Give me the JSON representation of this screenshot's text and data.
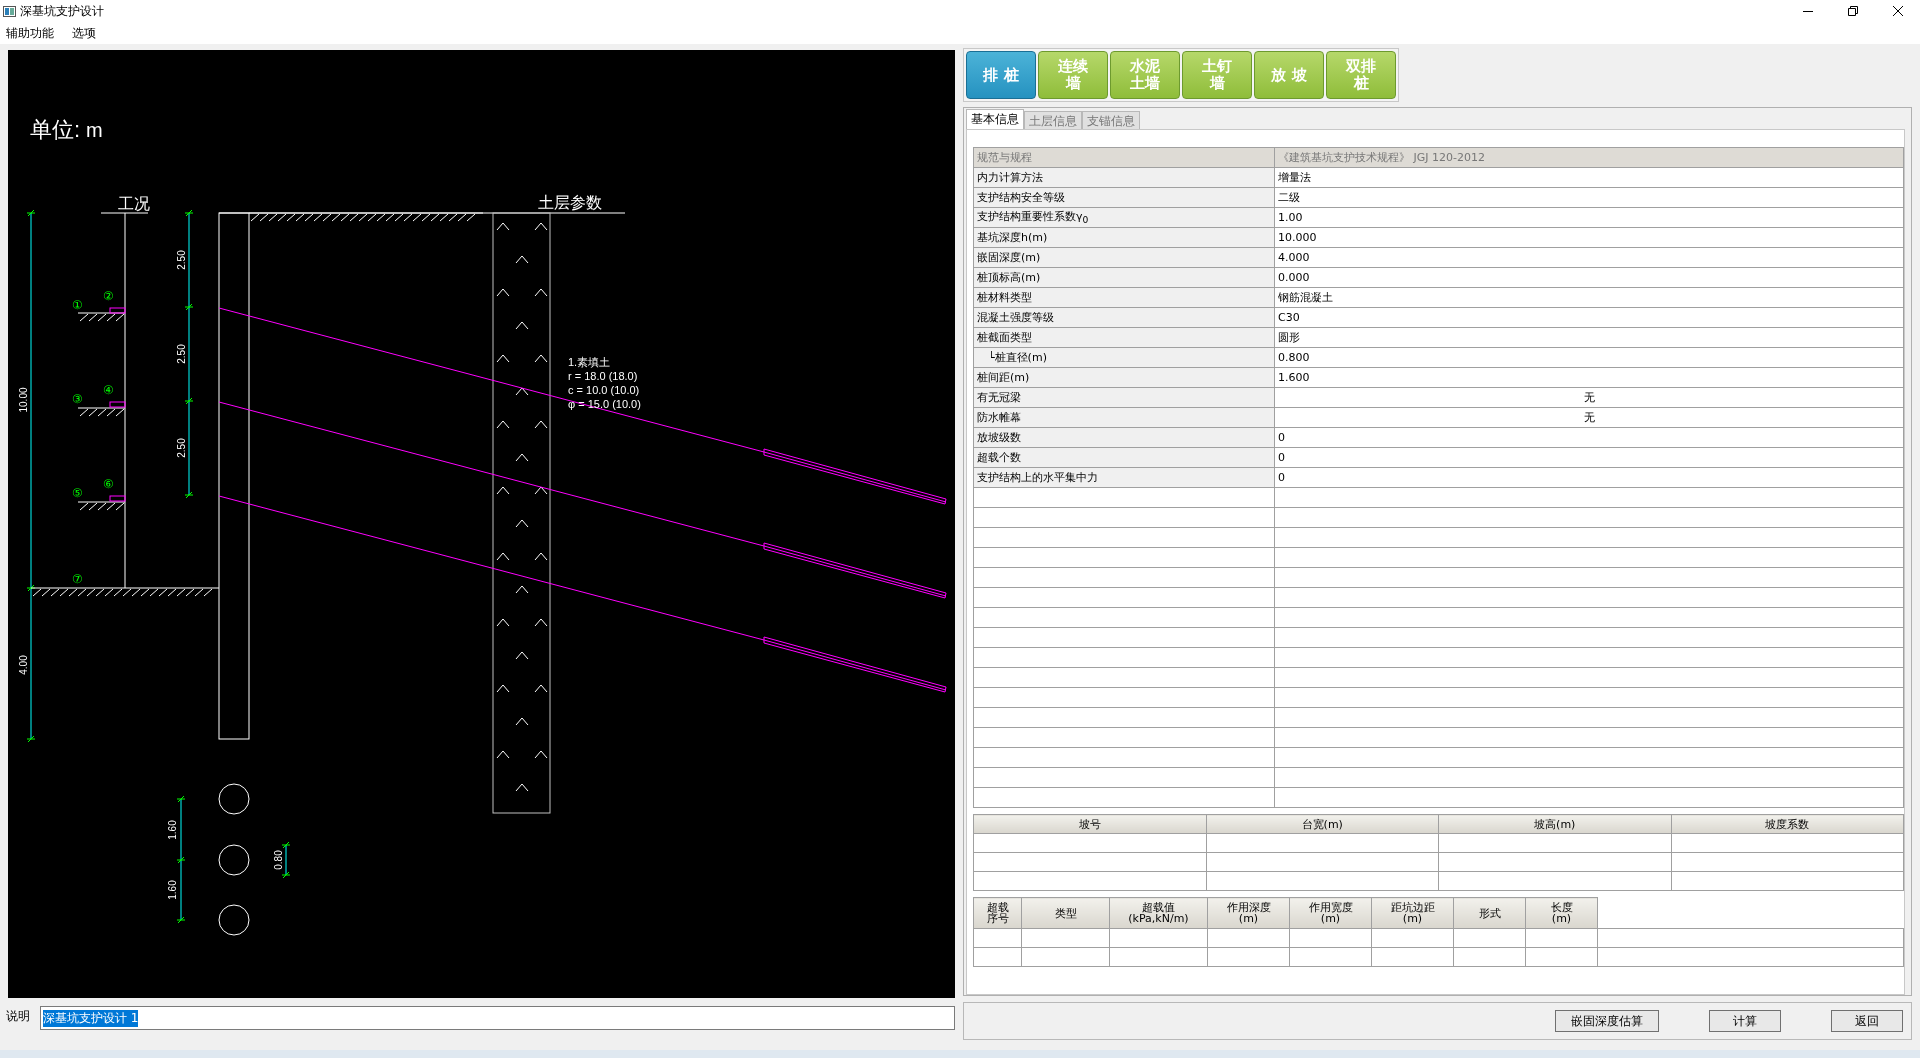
{
  "window": {
    "title": "深基坑支护设计"
  },
  "menu": [
    "辅助功能",
    "选项"
  ],
  "drawing": {
    "unit_label": "单位:",
    "unit": "m",
    "stage_title": "工况",
    "soil_title": "土层参数",
    "depth_dims": [
      "10.00",
      "4.00"
    ],
    "anchor_dims": [
      "2.50",
      "2.50",
      "2.50"
    ],
    "stage_marks": [
      "①",
      "②",
      "③",
      "④",
      "⑤",
      "⑥",
      "⑦"
    ],
    "soil_layer": [
      "1.素填土",
      "r = 18.0 (18.0)",
      "c = 10.0 (10.0)",
      "φ = 15.0 (10.0)"
    ],
    "spacing_dims": [
      "1.60",
      "1.60"
    ],
    "diameter_dim": "0.80"
  },
  "note": {
    "label": "说明",
    "value": "深基坑支护设计 1",
    "text_selected": true
  },
  "pile_types": [
    {
      "label": "排 桩",
      "selected": true
    },
    {
      "label": "连续墙",
      "selected": false
    },
    {
      "label": "水泥土墙",
      "selected": false
    },
    {
      "label": "土钉墙",
      "selected": false
    },
    {
      "label": "放 坡",
      "selected": false
    },
    {
      "label": "双排桩",
      "selected": false
    }
  ],
  "tabs": [
    {
      "label": "基本信息",
      "selected": true
    },
    {
      "label": "土层信息",
      "selected": false
    },
    {
      "label": "支锚信息",
      "selected": false
    }
  ],
  "basic_info": {
    "rows": [
      {
        "label": "规范与规程",
        "value": "《建筑基坑支护技术规程》 JGJ 120-2012",
        "kind": "readonly"
      },
      {
        "label": "内力计算方法",
        "value": "增量法",
        "kind": "text"
      },
      {
        "label": "支护结构安全等级",
        "value": "二级",
        "kind": "text"
      },
      {
        "label": "支护结构重要性系数γ$_{0}$",
        "value": "1.00",
        "kind": "text"
      },
      {
        "label": "基坑深度h(m)",
        "value": "10.000",
        "kind": "text"
      },
      {
        "label": "嵌固深度(m)",
        "value": "4.000",
        "kind": "text"
      },
      {
        "label": "桩顶标高(m)",
        "value": "0.000",
        "kind": "text"
      },
      {
        "label": "桩材料类型",
        "value": "钢筋混凝土",
        "kind": "text"
      },
      {
        "label": "混凝土强度等级",
        "value": "C30",
        "kind": "text"
      },
      {
        "label": "桩截面类型",
        "value": "圆形",
        "kind": "text",
        "children": [
          {
            "label": "└桩直径(m)",
            "value": "0.800",
            "kind": "text"
          }
        ]
      },
      {
        "label": "桩间距(m)",
        "value": "1.600",
        "kind": "text"
      },
      {
        "label": "有无冠梁",
        "value": "无",
        "kind": "choice"
      },
      {
        "label": "防水帷幕",
        "value": "无",
        "kind": "choice"
      },
      {
        "label": "放坡级数",
        "value": "0",
        "kind": "text"
      },
      {
        "label": "超载个数",
        "value": "0",
        "kind": "text"
      },
      {
        "label": "支护结构上的水平集中力",
        "value": "0",
        "kind": "text"
      }
    ]
  },
  "slope_table": {
    "columns": [
      "坡号",
      "台宽(m)",
      "坡高(m)",
      "坡度系数"
    ]
  },
  "surcharge_table": {
    "columns": [
      "超载序号",
      "类型",
      "超载值(kPa,kN/m)",
      "作用深度(m)",
      "作用宽度(m)",
      "距坑边距(m)",
      "形式",
      "长度(m)"
    ]
  },
  "buttons": [
    "嵌固深度估算",
    "计算",
    "返回"
  ]
}
